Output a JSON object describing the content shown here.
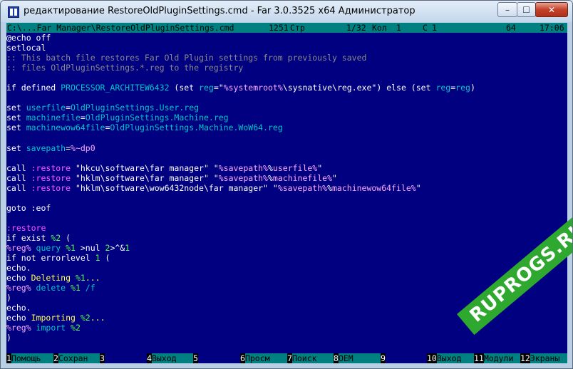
{
  "window": {
    "title": "редактирование RestoreOldPluginSettings.cmd - Far 3.0.3525 x64 Администратор",
    "min_glyph": "–",
    "max_glyph": "☐",
    "close_glyph": "✕"
  },
  "status": {
    "file": "C:\\...Far Manager\\RestoreOldPluginSettings.cmd",
    "codepage": "1251",
    "line_label": "Стр",
    "line": "1/32",
    "col_label": "Кол",
    "col": "1",
    "c_label": "С",
    "c_value": "1",
    "char_code": "64",
    "time": "17:06"
  },
  "editor": {
    "lines": [
      [
        {
          "t": "@echo off",
          "c": "w"
        }
      ],
      [
        {
          "t": "setlocal",
          "c": "w"
        }
      ],
      [
        {
          "t": ":: This batch file restores Far Old Plugin settings from previously saved",
          "c": "cm"
        }
      ],
      [
        {
          "t": ":: files OldPluginSettings.*.reg to the registry",
          "c": "cm"
        }
      ],
      [],
      [
        {
          "t": "if defined ",
          "c": "w"
        },
        {
          "t": "PROCESSOR_ARCHITEW6432",
          "c": "c"
        },
        {
          "t": " (set ",
          "c": "w"
        },
        {
          "t": "reg",
          "c": "c"
        },
        {
          "t": "=\"",
          "c": "w"
        },
        {
          "t": "%systemroot%",
          "c": "v"
        },
        {
          "t": "\\sysnative\\reg.exe\"",
          "c": "w"
        },
        {
          "t": ") else (set ",
          "c": "w"
        },
        {
          "t": "reg",
          "c": "c"
        },
        {
          "t": "=",
          "c": "w"
        },
        {
          "t": "reg",
          "c": "c"
        },
        {
          "t": ")",
          "c": "w"
        }
      ],
      [],
      [
        {
          "t": "set ",
          "c": "w"
        },
        {
          "t": "userfile",
          "c": "c"
        },
        {
          "t": "=",
          "c": "w"
        },
        {
          "t": "OldPluginSettings.User.reg",
          "c": "c"
        }
      ],
      [
        {
          "t": "set ",
          "c": "w"
        },
        {
          "t": "machinefile",
          "c": "c"
        },
        {
          "t": "=",
          "c": "w"
        },
        {
          "t": "OldPluginSettings.Machine.reg",
          "c": "c"
        }
      ],
      [
        {
          "t": "set ",
          "c": "w"
        },
        {
          "t": "machinewow64file",
          "c": "c"
        },
        {
          "t": "=",
          "c": "w"
        },
        {
          "t": "OldPluginSettings.Machine.WoW64.reg",
          "c": "c"
        }
      ],
      [],
      [
        {
          "t": "set ",
          "c": "w"
        },
        {
          "t": "savepath",
          "c": "c"
        },
        {
          "t": "=",
          "c": "w"
        },
        {
          "t": "%~dp0",
          "c": "v"
        }
      ],
      [],
      [
        {
          "t": "call ",
          "c": "w"
        },
        {
          "t": ":restore",
          "c": "m"
        },
        {
          "t": " \"hkcu\\software\\far manager\" \"",
          "c": "w"
        },
        {
          "t": "%savepath%",
          "c": "v"
        },
        {
          "t": "%",
          "c": "w"
        },
        {
          "t": "userfile%",
          "c": "v"
        },
        {
          "t": "\"",
          "c": "w"
        }
      ],
      [
        {
          "t": "call ",
          "c": "w"
        },
        {
          "t": ":restore",
          "c": "m"
        },
        {
          "t": " \"hklm\\software\\far manager\" \"",
          "c": "w"
        },
        {
          "t": "%savepath%",
          "c": "v"
        },
        {
          "t": "%",
          "c": "w"
        },
        {
          "t": "machinefile%",
          "c": "v"
        },
        {
          "t": "\"",
          "c": "w"
        }
      ],
      [
        {
          "t": "call ",
          "c": "w"
        },
        {
          "t": ":restore",
          "c": "m"
        },
        {
          "t": " \"hklm\\software\\wow6432node\\far manager\" \"",
          "c": "w"
        },
        {
          "t": "%savepath%",
          "c": "v"
        },
        {
          "t": "%",
          "c": "w"
        },
        {
          "t": "machinewow64file%",
          "c": "v"
        },
        {
          "t": "\"",
          "c": "w"
        }
      ],
      [],
      [
        {
          "t": "goto :eof",
          "c": "w"
        }
      ],
      [],
      [
        {
          "t": ":restore",
          "c": "m"
        }
      ],
      [
        {
          "t": "if exist ",
          "c": "w"
        },
        {
          "t": "%2",
          "c": "g"
        },
        {
          "t": " (",
          "c": "w"
        }
      ],
      [
        {
          "t": "%reg%",
          "c": "v"
        },
        {
          "t": " query ",
          "c": "c"
        },
        {
          "t": "%1",
          "c": "g"
        },
        {
          "t": " >nul ",
          "c": "w"
        },
        {
          "t": "2",
          "c": "g"
        },
        {
          "t": ">^&",
          "c": "w"
        },
        {
          "t": "1",
          "c": "g"
        }
      ],
      [
        {
          "t": "if not errorlevel ",
          "c": "w"
        },
        {
          "t": "1",
          "c": "g"
        },
        {
          "t": " (",
          "c": "w"
        }
      ],
      [
        {
          "t": "echo.",
          "c": "w"
        }
      ],
      [
        {
          "t": "echo",
          "c": "w"
        },
        {
          "t": " Deleting ",
          "c": "y"
        },
        {
          "t": "%1",
          "c": "g"
        },
        {
          "t": "...",
          "c": "y"
        }
      ],
      [
        {
          "t": "%reg%",
          "c": "v"
        },
        {
          "t": " delete ",
          "c": "c"
        },
        {
          "t": "%1",
          "c": "g"
        },
        {
          "t": " /f",
          "c": "c"
        }
      ],
      [
        {
          "t": ")",
          "c": "w"
        }
      ],
      [
        {
          "t": "echo.",
          "c": "w"
        }
      ],
      [
        {
          "t": "echo",
          "c": "w"
        },
        {
          "t": " Importing ",
          "c": "y"
        },
        {
          "t": "%2",
          "c": "g"
        },
        {
          "t": "...",
          "c": "y"
        }
      ],
      [
        {
          "t": "%reg%",
          "c": "v"
        },
        {
          "t": " import ",
          "c": "c"
        },
        {
          "t": "%2",
          "c": "g"
        }
      ],
      [
        {
          "t": ")",
          "c": "w"
        }
      ],
      [],
      []
    ]
  },
  "keybar": [
    {
      "num": "1",
      "label": "Помощь"
    },
    {
      "num": "2",
      "label": "Сохран"
    },
    {
      "num": "3",
      "label": ""
    },
    {
      "num": "4",
      "label": "Выход"
    },
    {
      "num": "5",
      "label": ""
    },
    {
      "num": "6",
      "label": "Просм"
    },
    {
      "num": "7",
      "label": "Поиск"
    },
    {
      "num": "8",
      "label": "OEM"
    },
    {
      "num": "9",
      "label": ""
    },
    {
      "num": "10",
      "label": "Выход"
    },
    {
      "num": "11",
      "label": "Модули"
    },
    {
      "num": "12",
      "label": "Экраны"
    }
  ],
  "watermark": "RUPROGS.RU",
  "colors": {
    "console_bg": "#000080",
    "status_bg": "#008080",
    "keybar_label_bg": "#008080"
  }
}
